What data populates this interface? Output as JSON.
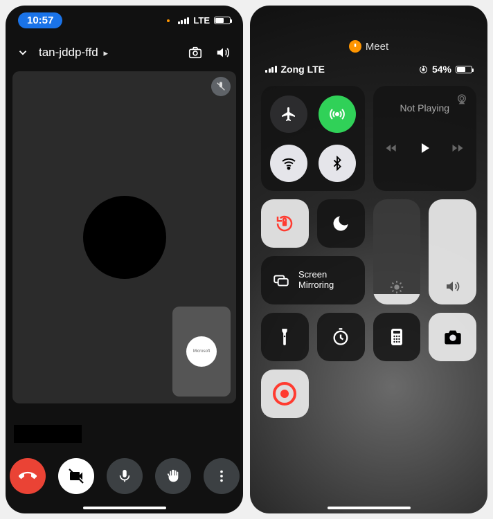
{
  "left": {
    "status": {
      "time": "10:57",
      "carrier": "LTE"
    },
    "header": {
      "meeting_id": "tan-jddp-ffd"
    },
    "self_view": {
      "avatar_label": "Microsoft"
    }
  },
  "right": {
    "pill": {
      "app": "Meet"
    },
    "status": {
      "carrier": "Zong LTE",
      "battery": "54%"
    },
    "media": {
      "now_playing": "Not Playing"
    },
    "mirror": {
      "line1": "Screen",
      "line2": "Mirroring"
    }
  }
}
